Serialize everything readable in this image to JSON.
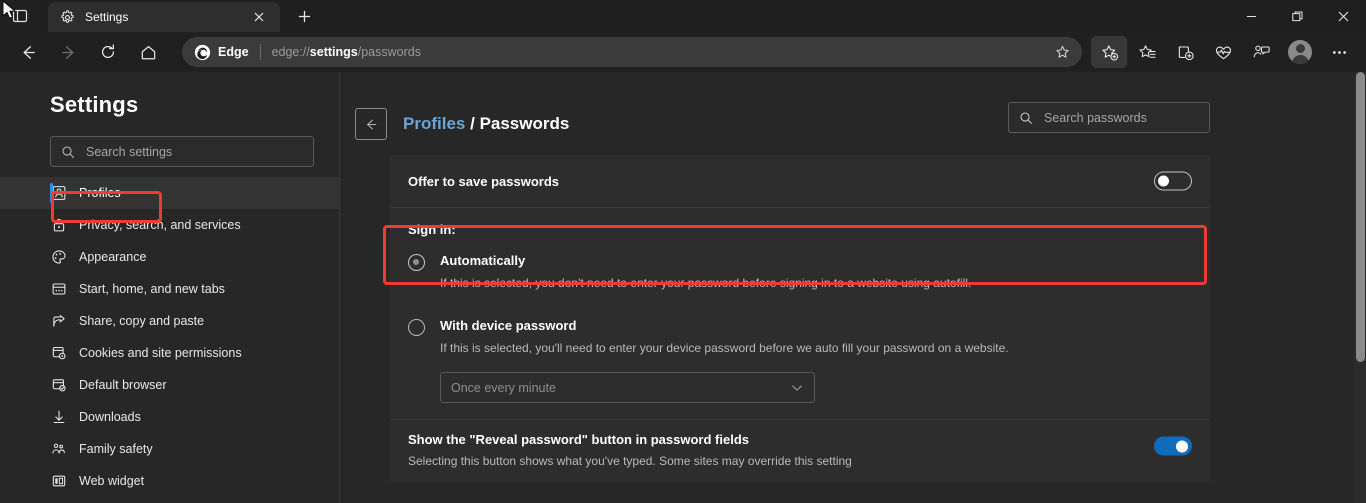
{
  "window": {
    "tab_actions_icon": "tab-actions-icon",
    "minimize_label": "—",
    "maximize_label": "❐",
    "close_label": "✕"
  },
  "tab": {
    "title": "Settings",
    "favicon": "gear-icon",
    "close_label": "✕",
    "newtab_label": "+"
  },
  "navbar": {
    "back_icon": "back-arrow-icon",
    "forward_icon": "forward-arrow-icon",
    "refresh_icon": "refresh-icon",
    "home_icon": "home-icon",
    "brand_label": "Edge",
    "url_prefix": "edge://",
    "url_bold": "settings",
    "url_suffix": "/passwords",
    "favorite_icon": "add-favorite-star-icon",
    "toolbar_icons": [
      "favorites-icon",
      "collections-icon",
      "browser-essentials-icon",
      "copilot-icon"
    ],
    "profile_icon": "profile-avatar-icon",
    "settings_more_label": "⋯"
  },
  "sidebar": {
    "title": "Settings",
    "search": {
      "placeholder": "Search settings",
      "icon": "search-icon"
    },
    "items": [
      {
        "label": "Profiles",
        "icon": "profiles-icon",
        "selected": true
      },
      {
        "label": "Privacy, search, and services",
        "icon": "lock-icon",
        "selected": false
      },
      {
        "label": "Appearance",
        "icon": "palette-icon",
        "selected": false
      },
      {
        "label": "Start, home, and new tabs",
        "icon": "start-home-icon",
        "selected": false
      },
      {
        "label": "Share, copy and paste",
        "icon": "share-icon",
        "selected": false
      },
      {
        "label": "Cookies and site permissions",
        "icon": "cookies-icon",
        "selected": false
      },
      {
        "label": "Default browser",
        "icon": "default-browser-icon",
        "selected": false
      },
      {
        "label": "Downloads",
        "icon": "download-icon",
        "selected": false
      },
      {
        "label": "Family safety",
        "icon": "family-safety-icon",
        "selected": false
      },
      {
        "label": "Web widget",
        "icon": "web-widget-icon",
        "selected": false
      }
    ]
  },
  "main": {
    "back_icon": "back-arrow-icon",
    "breadcrumb": {
      "parent": "Profiles",
      "separator": "/",
      "current": "Passwords"
    },
    "search": {
      "placeholder": "Search passwords",
      "icon": "search-icon"
    },
    "offer_to_save": {
      "label": "Offer to save passwords",
      "toggle_state": "off"
    },
    "sign_in": {
      "title": "Sign in:",
      "options": [
        {
          "label": "Automatically",
          "description": "If this is selected, you don't need to enter your password before signing in to a website using autofill.",
          "selected": true
        },
        {
          "label": "With device password",
          "description": "If this is selected, you'll need to enter your device password before we auto fill your password on a website.",
          "selected": false
        }
      ],
      "frequency_select": {
        "value": "Once every minute",
        "chevron": "chevron-down-icon"
      }
    },
    "reveal_password": {
      "label": "Show the \"Reveal password\" button in password fields",
      "description": "Selecting this button shows what you've typed. Some sites may override this setting",
      "toggle_state": "on"
    }
  },
  "colors": {
    "accent_blue": "#0f6cbd",
    "link_blue": "#6ba4d8",
    "highlight_red": "#ef3b31",
    "page_bg": "#272727",
    "card_bg": "#2d2d2d"
  }
}
